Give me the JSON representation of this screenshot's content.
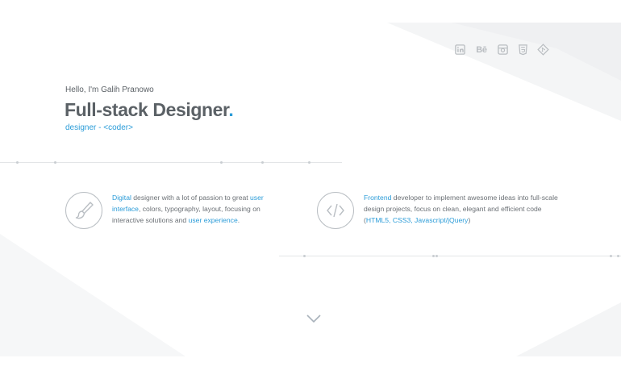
{
  "social": {
    "icons": [
      "linkedin-icon",
      "behance-icon",
      "instagram-icon",
      "html5-icon",
      "git-icon"
    ],
    "behance_label": "Bē"
  },
  "hero": {
    "greeting": "Hello, I'm Galih Pranowo",
    "title": "Full-stack Designer",
    "title_dot": ".",
    "subtitle": "designer - <coder>"
  },
  "designer_card": {
    "icon": "brush-icon",
    "text": {
      "w1": "Digital",
      "t1": " designer with a lot of passion to great ",
      "w2": "user interface",
      "t2": ", colors, typography, layout, focusing on interactive solutions and ",
      "w3": "user experience",
      "t3": "."
    }
  },
  "coder_card": {
    "icon": "code-icon",
    "text": {
      "w1": "Frontend",
      "t1": " developer to implement awesome ideas into full-scale design projects, focus on clean, elegant and efficient code (",
      "w2": "HTML5, CSS3, Javascript/jQuery",
      "t2": ")"
    }
  },
  "scroll": {
    "icon": "chevron-down-icon"
  },
  "colors": {
    "accent": "#2b9cd8",
    "text": "#5b6166",
    "muted": "#b9bdc1",
    "background": "#ffffff"
  }
}
